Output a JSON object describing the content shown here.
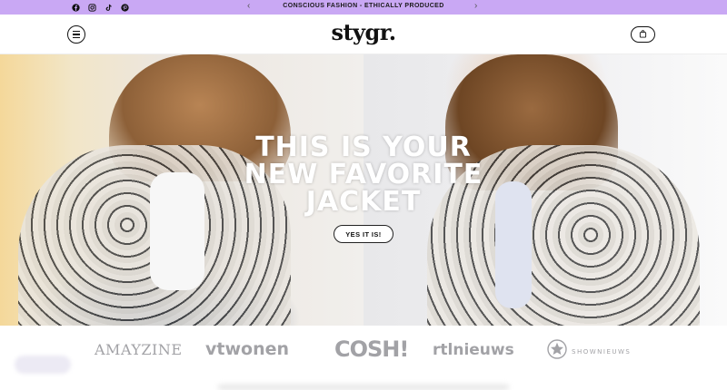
{
  "announcement": {
    "text": "CONSCIOUS FASHION - ETHICALLY PRODUCED",
    "prev_arrow": "‹",
    "next_arrow": "›",
    "background": "#c9a8f4"
  },
  "social_icons": [
    "facebook-icon",
    "instagram-icon",
    "tiktok-icon",
    "pinterest-icon"
  ],
  "header": {
    "logo": "stygr.",
    "menu_icon": "hamburger-menu-icon",
    "cart_icon": "shopping-bag-icon"
  },
  "hero": {
    "headline_line1": "THIS IS YOUR",
    "headline_line2": "NEW FAVORITE",
    "headline_line3": "JACKET",
    "cta_label": "YES IT IS!"
  },
  "press": {
    "logos": [
      "AMAYZINE",
      "vtwonen",
      "COSH!",
      "rtlnieuws",
      "SHOWNIEUWS"
    ]
  }
}
